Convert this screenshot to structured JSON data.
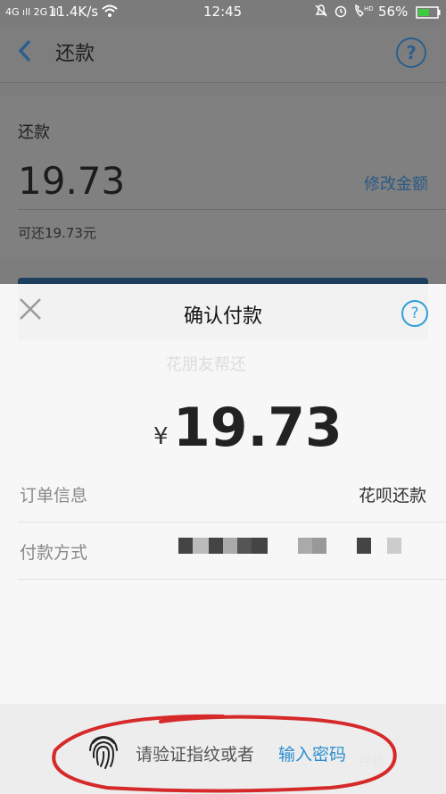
{
  "status_bar": {
    "signal_left": "4G ıll 2G ıll",
    "net_speed": "11.4K/s",
    "time": "12:45",
    "battery": "56%"
  },
  "background_page": {
    "header_title": "还款",
    "help_glyph": "?",
    "card_label": "还款",
    "amount": "19.73",
    "edit_link": "修改金额",
    "available": "可还19.73元",
    "ghost_text": "花朋友帮还"
  },
  "modal": {
    "title": "确认付款",
    "close_glyph": "✕",
    "help_glyph": "?",
    "currency": "¥",
    "amount": "19.73",
    "rows": [
      {
        "label": "订单信息",
        "value": "花呗还款"
      },
      {
        "label": "付款方式",
        "value": ""
      }
    ]
  },
  "footer": {
    "prompt": "请验证指纹或者",
    "link": "输入密码",
    "watermark": "经验"
  },
  "colors": {
    "accent": "#2d8fd0",
    "annotation_red": "#d62a2a"
  }
}
